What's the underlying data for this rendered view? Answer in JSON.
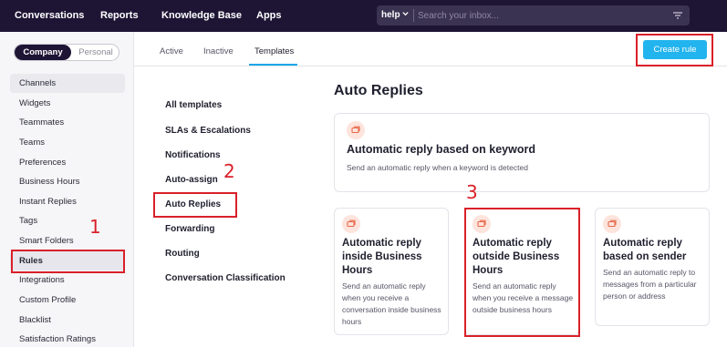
{
  "topnav": {
    "items": [
      "Conversations",
      "Reports",
      "Knowledge Base",
      "Apps"
    ],
    "search_scope": "help",
    "search_placeholder": "Search your inbox..."
  },
  "sidebar": {
    "toggle": {
      "company": "Company",
      "personal": "Personal"
    },
    "items": [
      "Channels",
      "Widgets",
      "Teammates",
      "Teams",
      "Preferences",
      "Business Hours",
      "Instant Replies",
      "Tags",
      "Smart Folders",
      "Rules",
      "Integrations",
      "Custom Profile",
      "Blacklist",
      "Satisfaction Ratings"
    ],
    "active_item": "Rules"
  },
  "tabs": {
    "items": [
      "Active",
      "Inactive",
      "Templates"
    ],
    "active": "Templates"
  },
  "create_rule_label": "Create rule",
  "categories": {
    "items": [
      "All templates",
      "SLAs & Escalations",
      "Notifications",
      "Auto-assign",
      "Auto Replies",
      "Forwarding",
      "Routing",
      "Conversation Classification"
    ],
    "active": "Auto Replies"
  },
  "heading": "Auto Replies",
  "cards": [
    {
      "title": "Automatic reply based on keyword",
      "desc": "Send an automatic reply when a keyword is detected"
    },
    {
      "title": "Automatic reply inside Business Hours",
      "desc": "Send an automatic reply when you receive a conversation inside business hours"
    },
    {
      "title": "Automatic reply outside Business Hours",
      "desc": "Send an automatic reply when you receive a message outside business hours"
    },
    {
      "title": "Automatic reply based on sender",
      "desc": "Send an automatic reply to messages from a particular person or address"
    }
  ],
  "annotations": [
    "1",
    "2",
    "3"
  ],
  "colors": {
    "topbar": "#1e1535",
    "accent": "#22b4ee",
    "annotation": "#d92029",
    "icon_bg": "#fde4dc",
    "icon": "#e8684a"
  }
}
